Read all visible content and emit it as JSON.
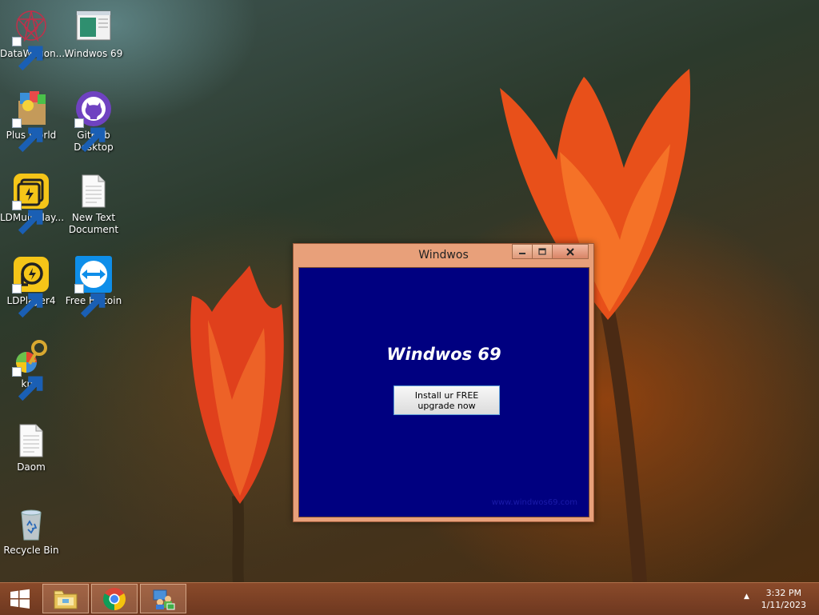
{
  "desktop": {
    "icons": [
      {
        "label": "DataWagon...",
        "icon": "datawagon-icon"
      },
      {
        "label": "Windwos 69",
        "icon": "window-app-icon"
      },
      {
        "label": "Plus World",
        "icon": "plus-world-icon"
      },
      {
        "label": "GitHub Desktop",
        "icon": "github-icon"
      },
      {
        "label": "LDMultiPlay...",
        "icon": "ldmultiplayer-icon"
      },
      {
        "label": "New Text Document",
        "icon": "text-document-icon"
      },
      {
        "label": "LDPlayer4",
        "icon": "ldplayer-icon"
      },
      {
        "label": "Free Bitcoin",
        "icon": "teamviewer-icon"
      },
      {
        "label": "kms",
        "icon": "kms-key-icon"
      },
      {
        "label": "Daom",
        "icon": "text-document-icon"
      },
      {
        "label": "Recycle Bin",
        "icon": "recycle-bin-icon"
      }
    ]
  },
  "window": {
    "title": "Windwos",
    "heading": "Windwos 69",
    "button_label": "Install ur FREE upgrade now",
    "footer_link": "www.windwos69.com"
  },
  "taskbar": {
    "items": [
      "file-explorer-icon",
      "chrome-icon",
      "network-users-icon"
    ],
    "time": "3:32 PM",
    "date": "1/11/2023"
  },
  "colors": {
    "window_frame": "#e8a07a",
    "client_bg": "#000080",
    "taskbar": "#7a3f24"
  }
}
